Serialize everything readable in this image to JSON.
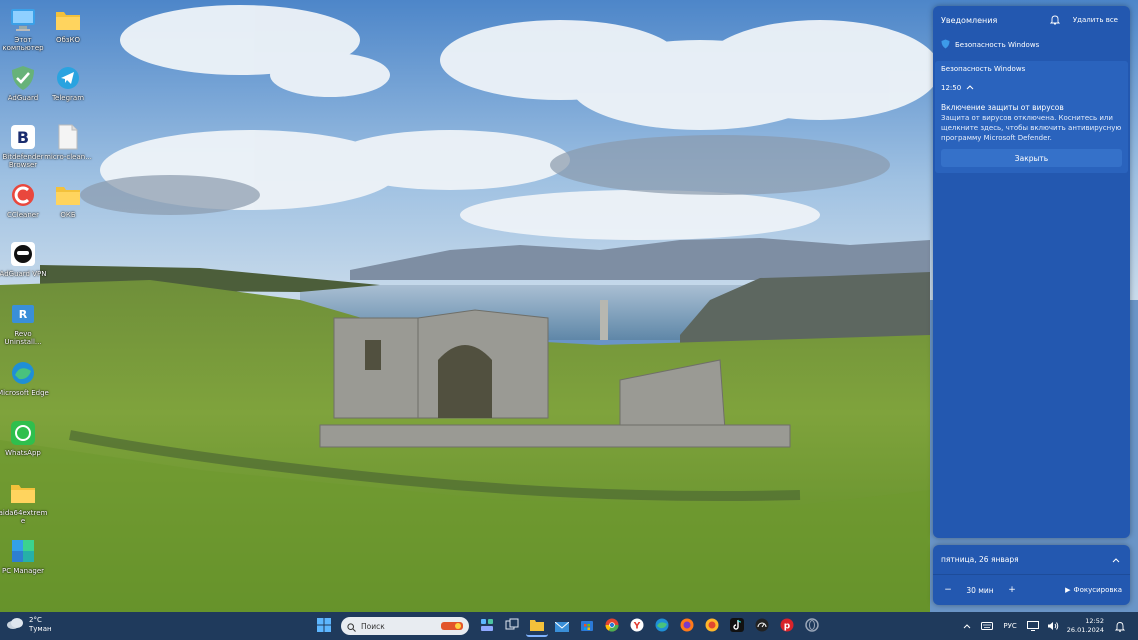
{
  "desktop": {
    "icons": [
      {
        "label": "Этот компьютер",
        "icon": "computer-icon"
      },
      {
        "label": "ОбзКО",
        "icon": "folder-icon"
      },
      {
        "label": "AdGuard",
        "icon": "adguard-icon"
      },
      {
        "label": "Telegram",
        "icon": "telegram-icon"
      },
      {
        "label": "Bitdefender Browser",
        "icon": "browser-icon"
      },
      {
        "label": "micro-clean...",
        "icon": "file-icon"
      },
      {
        "label": "CCleaner",
        "icon": "ccleaner-icon"
      },
      {
        "label": "ОКБ",
        "icon": "folder-icon"
      },
      {
        "label": "AdGuard VPN",
        "icon": "adguard-vpn-icon"
      },
      {
        "label": "Revo Uninstall...",
        "icon": "revo-icon"
      },
      {
        "label": "Microsoft Edge",
        "icon": "edge-icon"
      },
      {
        "label": "WhatsApp",
        "icon": "whatsapp-icon"
      },
      {
        "label": "aida64extreme",
        "icon": "folder-icon"
      },
      {
        "label": "PC Manager",
        "icon": "pc-manager-icon"
      }
    ]
  },
  "notifications": {
    "title": "Уведомления",
    "clear_all": "Удалить все",
    "app_name": "Безопасность Windows",
    "group_header": "Безопасность Windows",
    "time": "12:50",
    "card_title": "Включение защиты от вирусов",
    "card_body": "Защита от вирусов отключена. Коснитесь или щелкните здесь, чтобы включить антивирусную программу Microsoft Defender.",
    "close_button": "Закрыть"
  },
  "calendar": {
    "date": "пятница, 26 января",
    "focus_minutes": "30 мин",
    "focus_button": "Фокусировка",
    "minus": "−",
    "plus": "+"
  },
  "taskbar": {
    "weather_temp": "2°C",
    "weather_desc": "Туман",
    "search_placeholder": "Поиск",
    "language": "РУС",
    "time": "12:52",
    "date": "26.01.2024",
    "apps": [
      "start-icon",
      "search",
      "widgets-icon",
      "task-view-icon",
      "file-explorer-icon",
      "mail-icon",
      "store-icon",
      "chrome-icon",
      "yandex-icon",
      "edge-icon",
      "firefox-icon",
      "firefox-dev-icon",
      "tiktok-icon",
      "speedometer-icon",
      "pinterest-icon",
      "opera-icon"
    ]
  },
  "colors": {
    "panel": "#2358b0",
    "taskbar": "#1f3a5c",
    "accent": "#7fb3ff"
  }
}
